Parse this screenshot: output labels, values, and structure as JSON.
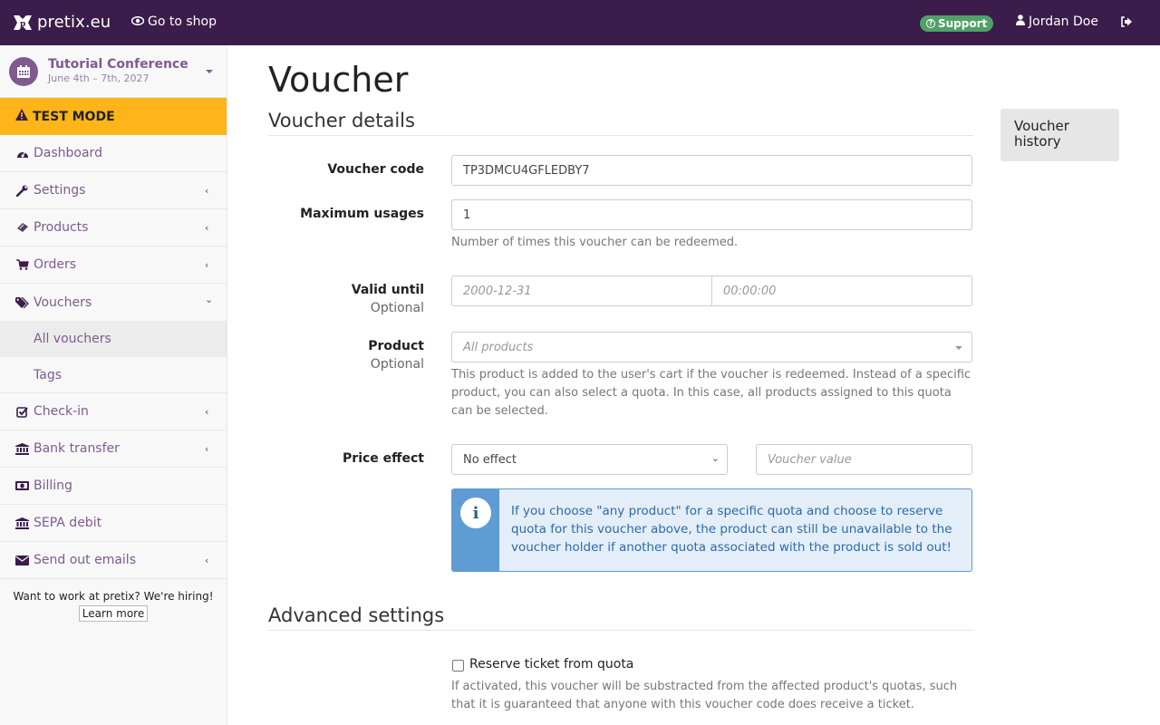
{
  "navbar": {
    "brand": "pretix.eu",
    "go_to_shop": "Go to shop",
    "support": "Support",
    "user": "Jordan Doe"
  },
  "sidebar": {
    "event_name": "Tutorial Conference",
    "event_date": "June 4th – 7th, 2027",
    "test_mode": "TEST MODE",
    "items": [
      {
        "label": "Dashboard",
        "icon": "dashboard-icon",
        "chevron": ""
      },
      {
        "label": "Settings",
        "icon": "wrench-icon",
        "chevron": "‹"
      },
      {
        "label": "Products",
        "icon": "ticket-icon",
        "chevron": "‹"
      },
      {
        "label": "Orders",
        "icon": "cart-icon",
        "chevron": "‹"
      },
      {
        "label": "Vouchers",
        "icon": "tags-icon",
        "chevron": "⌄"
      }
    ],
    "sub_items": [
      {
        "label": "All vouchers",
        "active": true
      },
      {
        "label": "Tags",
        "active": false
      }
    ],
    "items_after": [
      {
        "label": "Check-in",
        "icon": "check-square-icon",
        "chevron": "‹"
      },
      {
        "label": "Bank transfer",
        "icon": "bank-icon",
        "chevron": "‹"
      },
      {
        "label": "Billing",
        "icon": "money-icon",
        "chevron": ""
      },
      {
        "label": "SEPA debit",
        "icon": "bank-icon",
        "chevron": ""
      },
      {
        "label": "Send out emails",
        "icon": "envelope-icon",
        "chevron": "‹"
      }
    ],
    "hiring_text": "Want to work at pretix? We're hiring!",
    "learn_more": "Learn more"
  },
  "main": {
    "title": "Voucher",
    "section_details": "Voucher details",
    "voucher_code_label": "Voucher code",
    "voucher_code_value": "TP3DMCU4GFLEDBY7",
    "max_usages_label": "Maximum usages",
    "max_usages_value": "1",
    "max_usages_help": "Number of times this voucher can be redeemed.",
    "valid_until_label": "Valid until",
    "optional": "Optional",
    "valid_date_placeholder": "2000-12-31",
    "valid_time_placeholder": "00:00:00",
    "product_label": "Product",
    "product_placeholder": "All products",
    "product_help": "This product is added to the user's cart if the voucher is redeemed. Instead of a specific product, you can also select a quota. In this case, all products assigned to this quota can be selected.",
    "price_effect_label": "Price effect",
    "price_effect_value": "No effect",
    "voucher_value_placeholder": "Voucher value",
    "info_text": "If you choose \"any product\" for a specific quota and choose to reserve quota for this voucher above, the product can still be unavailable to the voucher holder if another quota associated with the product is sold out!",
    "section_advanced": "Advanced settings",
    "reserve_label": "Reserve ticket from quota",
    "reserve_checked": false,
    "reserve_help": "If activated, this voucher will be substracted from the affected product's quotas, such that it is guaranteed that anyone with this voucher code does receive a ticket.",
    "history_button": "Voucher history"
  }
}
